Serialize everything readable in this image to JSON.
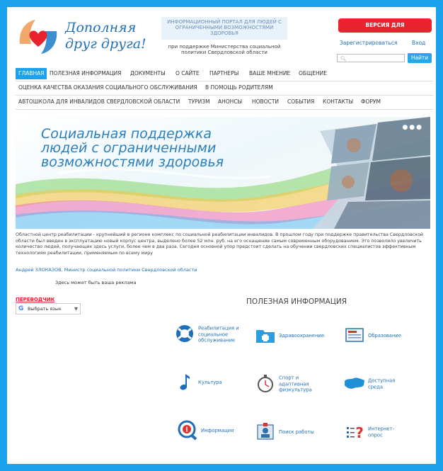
{
  "header": {
    "brand_line1": "Дополняя",
    "brand_line2": "друг друга!",
    "info_box": "ИНФОРМАЦИОННЫЙ ПОРТАЛ ДЛЯ ЛЮДЕЙ С ОГРАНИЧЕННЫМИ ВОЗМОЖНОСТЯМИ ЗДОРОВЬЯ",
    "support_text": "при поддержке Министерства социальной политики Свердловской области",
    "low_vision_button": "ВЕРСИЯ ДЛЯ СЛАБОВИДЯЩИХ",
    "register_link": "Зарегистрироваться",
    "login_link": "Вход",
    "search_placeholder": "",
    "search_button": "Найти"
  },
  "nav": {
    "row1": [
      "ГЛАВНАЯ",
      "ПОЛЕЗНАЯ ИНФОРМАЦИЯ",
      "ДОКУМЕНТЫ",
      "О САЙТЕ",
      "ПАРТНЕРЫ",
      "ВАШЕ МНЕНИЕ",
      "ОБЩЕНИЕ"
    ],
    "row2": [
      "ОЦЕНКА КАЧЕСТВА ОКАЗАНИЯ СОЦИАЛЬНОГО ОБСЛУЖИВАНИЯ",
      "В ПОМОЩЬ РОДИТЕЛЯМ"
    ],
    "row3": [
      "АВТОШКОЛА ДЛЯ ИНВАЛИДОВ СВЕРДЛОВСКОЙ ОБЛАСТИ",
      "ТУРИЗМ",
      "АНОНСЫ",
      "НОВОСТИ",
      "СОБЫТИЯ",
      "КОНТАКТЫ",
      "ФОРУМ"
    ],
    "active": "ГЛАВНАЯ"
  },
  "banner": {
    "title_line1": "Социальная поддержка",
    "title_line2": "людей с ограниченными",
    "title_line3": "возможностями здоровья"
  },
  "main": {
    "paragraph": "Областной центр реабилитации - крупнейший в регионе комплекс по социальной реабилитации инвалидов. В прошлом году при поддержке правительства Свердловской области был введен в эксплуатацию новый корпус центра, выделено более 52 млн. руб. на его оснащение самым современным оборудованием. Это позволило увеличить количество людей, получающих здесь услуги, более чем в два раза. Сегодня основной упор предстоит сделать на обучении свердловских специалистов эффективным технологиям реабилитации, применяемым по всему миру",
    "author": "Андрей ЗЛОКАЗОВ, Министр социальной политики Свердловской области",
    "ad_text": "Здесь может быть ваша реклама",
    "translator_label": "ПЕРЕВОДЧИК",
    "translate_widget": "Выбрать язык",
    "section_title": "ПОЛЕЗНАЯ ИНФОРМАЦИЯ"
  },
  "tiles": [
    {
      "label": "Реабилитация и социальное обслуживание",
      "icon": "lifebuoy-icon"
    },
    {
      "label": "Здравоохранение",
      "icon": "medical-folder-icon"
    },
    {
      "label": "Образование",
      "icon": "diploma-icon"
    },
    {
      "label": "Культура",
      "icon": "music-note-icon"
    },
    {
      "label": "Спорт и адаптивная физкультура",
      "icon": "stopwatch-icon"
    },
    {
      "label": "Доступная среда",
      "icon": "map-icon"
    },
    {
      "label": "Информация",
      "icon": "info-icon"
    },
    {
      "label": "Поиск работы",
      "icon": "id-card-icon"
    },
    {
      "label": "Интернет-опрос",
      "icon": "survey-icon"
    }
  ],
  "colors": {
    "frame": "#1aa3ec",
    "accent_blue": "#1f6fb8",
    "low_vision_red": "#e8232d",
    "nav_active": "#1aa3ec"
  }
}
